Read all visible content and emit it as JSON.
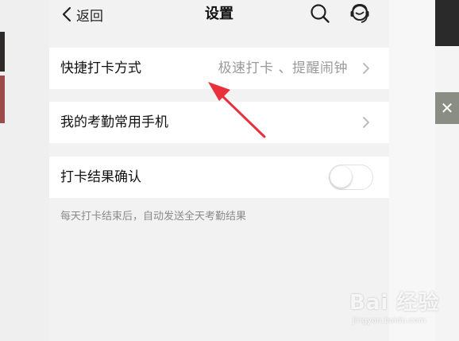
{
  "nav": {
    "back_label": "返回",
    "title": "设置"
  },
  "settings": {
    "quick_checkin": {
      "label": "快捷打卡方式",
      "value": "极速打卡 、提醒闹钟"
    },
    "phone": {
      "label": "我的考勤常用手机"
    },
    "result_confirm": {
      "label": "打卡结果确认",
      "enabled": false,
      "hint": "每天打卡结束后，自动发送全天考勤结果"
    }
  },
  "watermark": {
    "brand": "Bai 经验",
    "url": "jingyan.baidu.com"
  },
  "colors": {
    "annotation_arrow": "#e8313a",
    "secondary_text": "#9a9a9a",
    "background": "#f2f2f2"
  }
}
